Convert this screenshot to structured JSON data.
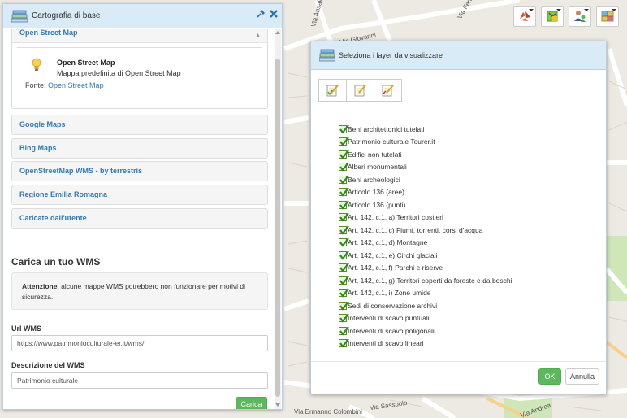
{
  "map": {
    "streets": [
      "Via Giovanni",
      "Via Sassuolo",
      "Via Ermanno Colombini",
      "Via Ferrari",
      "Via Ansaldo",
      "Via Andrea"
    ]
  },
  "toolbar": {
    "tools": [
      {
        "icon": "recycle-arrows-icon"
      },
      {
        "icon": "layers-map-icon"
      },
      {
        "icon": "users-icon"
      },
      {
        "icon": "grid-map-icon"
      }
    ]
  },
  "left_panel": {
    "title": "Cartografia di base",
    "open_section": {
      "label": "Open Street Map",
      "item_name": "Open Street Map",
      "item_desc": "Mappa predefinita di Open Street Map",
      "source_label": "Fonte:",
      "source_link": "Open Street Map"
    },
    "sections": [
      "Google Maps",
      "Bing Maps",
      "OpenStreetMap WMS - by terrestris",
      "Regione Emilia Romagna",
      "Caricate dall'utente"
    ],
    "wms": {
      "title": "Carica un tuo WMS",
      "warning_bold": "Attenzione",
      "warning_text": ", alcune mappe WMS potrebbero non funzionare per motivi di sicurezza.",
      "url_label": "Url WMS",
      "url_value": "https://www.patrimonioculturale-er.it/wms/",
      "desc_label": "Descrizione del WMS",
      "desc_value": "Patrimonio culturale",
      "button": "Carica"
    }
  },
  "dialog": {
    "title": "Seleziona i layer da visualizzare",
    "layers": [
      "Beni architettonici tutelati",
      "Patrimonio culturale Tourer.it",
      "Edifici non tutelati",
      "Alberi monumentali",
      "Beni archeologici",
      "Articolo 136 (aree)",
      "Articolo 136 (punti)",
      "Art. 142, c.1, a) Territori costieri",
      "Art. 142, c.1, c) Fiumi, torrenti, corsi d'acqua",
      "Art. 142, c.1, d) Montagne",
      "Art. 142, c.1, e) Circhi glaciali",
      "Art. 142, c.1, f) Parchi e riserve",
      "Art. 142, c.1, g) Territori coperti da foreste e da boschi",
      "Art. 142, c.1, i) Zone umide",
      "Sedi di conservazione archivi",
      "Interventi di scavo puntuali",
      "Interventi di scavo poligonali",
      "Interventi di scavo lineari"
    ],
    "ok": "OK",
    "cancel": "Annulla"
  }
}
